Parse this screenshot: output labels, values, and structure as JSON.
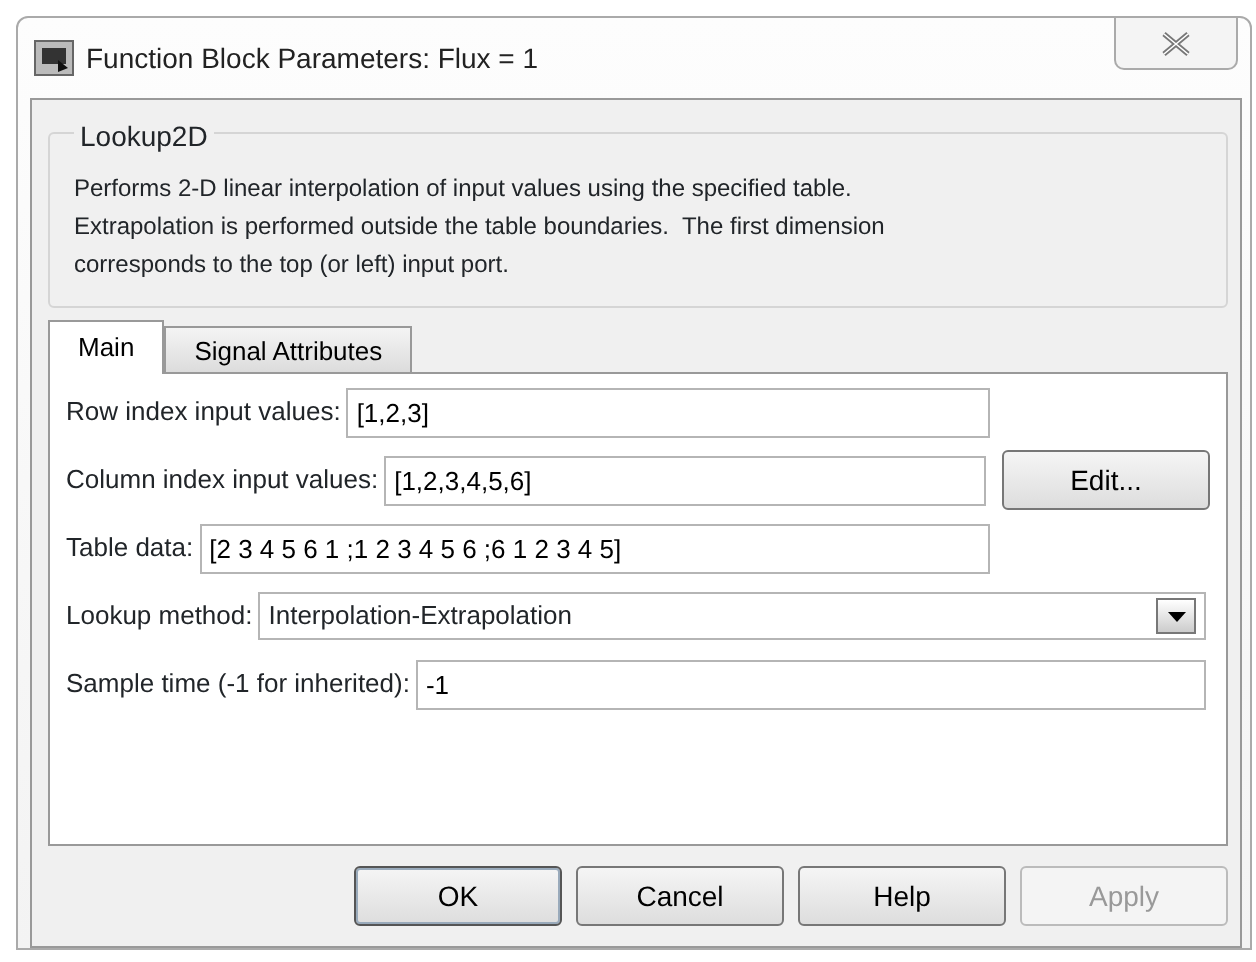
{
  "window": {
    "title": "Function Block Parameters: Flux = 1"
  },
  "group": {
    "title": "Lookup2D",
    "description": "Performs 2-D linear interpolation of input values using the specified table.\nExtrapolation is performed outside the table boundaries.  The first dimension\ncorresponds to the top (or left) input port."
  },
  "tabs": [
    {
      "label": "Main",
      "selected": true
    },
    {
      "label": "Signal Attributes",
      "selected": false
    }
  ],
  "parameters": [
    {
      "kind": "text",
      "label": "Row index input values:",
      "value": "[1,2,3]",
      "wide": false
    },
    {
      "kind": "text",
      "label": "Column index input values:",
      "value": "[1,2,3,4,5,6]",
      "button": "Edit..."
    },
    {
      "kind": "text",
      "label": "Table data:",
      "value": "[2 3 4 5 6 1 ;1 2 3 4 5 6 ;6 1 2 3 4 5]",
      "wide": false
    },
    {
      "kind": "dropdown",
      "label": "Lookup method:",
      "value": "Interpolation-Extrapolation",
      "wide": true
    },
    {
      "kind": "text",
      "label": "Sample time (-1 for inherited):",
      "value": "-1",
      "wide": true
    }
  ],
  "buttons": [
    {
      "label": "OK",
      "disabled": false,
      "default": true
    },
    {
      "label": "Cancel",
      "disabled": false,
      "default": false
    },
    {
      "label": "Help",
      "disabled": false,
      "default": false
    },
    {
      "label": "Apply",
      "disabled": true,
      "default": false
    }
  ]
}
